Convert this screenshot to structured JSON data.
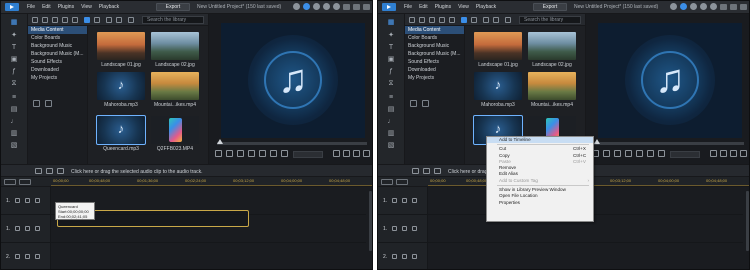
{
  "menu": [
    "File",
    "Edit",
    "Plugins",
    "View",
    "Playback"
  ],
  "export_label": "Export",
  "project_title": "New Untitled Project* (150 last saved)",
  "search_placeholder": "Search the library",
  "categories": [
    "Media Content",
    "Color Boards",
    "Background Music",
    "Background Music (M...",
    "Sound Effects",
    "Downloaded",
    "My Projects"
  ],
  "media_items": [
    "Landscape 01.jpg",
    "Landscape 02.jpg",
    "Mahoroba.mp3",
    "Mountai...ikes.mp4",
    "Queencard.mp3",
    "Q2FFB023.MP4"
  ],
  "hint_left": "Click here or drag the selected audio clip to the audio track.",
  "hint_right": "Click here or drag the selected audio clip to the audio track.",
  "ruler_ticks": [
    "00;00;00",
    "00;00;48;00",
    "00;01;36;00",
    "00;02;24;00",
    "00;03;12;00",
    "00;04;00;00",
    "00;04;48;00"
  ],
  "track_numbers": [
    "1.",
    "1.",
    "2."
  ],
  "tooltip": {
    "line1": "Queencard",
    "line2": "Start:00;00;00;00",
    "line3": "End:00;02;41;05"
  },
  "context_menu": {
    "items": [
      {
        "label": "Add to Timeline",
        "shortcut": "",
        "state": "highlighted"
      },
      {
        "label": "Cut",
        "shortcut": "Ctrl+X",
        "state": "normal"
      },
      {
        "label": "Copy",
        "shortcut": "Ctrl+C",
        "state": "normal"
      },
      {
        "label": "Paste",
        "shortcut": "Ctrl+V",
        "state": "disabled"
      },
      {
        "label": "Remove",
        "shortcut": "",
        "state": "normal"
      },
      {
        "label": "Edit Alias",
        "shortcut": "",
        "state": "normal"
      },
      {
        "label": "Add to Custom Tag",
        "shortcut": "",
        "state": "disabled"
      },
      {
        "label": "Show in Library Preview Window",
        "shortcut": "",
        "state": "normal"
      },
      {
        "label": "Open File Location",
        "shortcut": "",
        "state": "normal"
      },
      {
        "label": "Properties",
        "shortcut": "",
        "state": "normal"
      }
    ]
  },
  "colors": {
    "accent": "#3b8ee8",
    "selection": "#2c4f78",
    "ruler": "#c9a848",
    "menu_highlight": "#c8ddf3"
  }
}
